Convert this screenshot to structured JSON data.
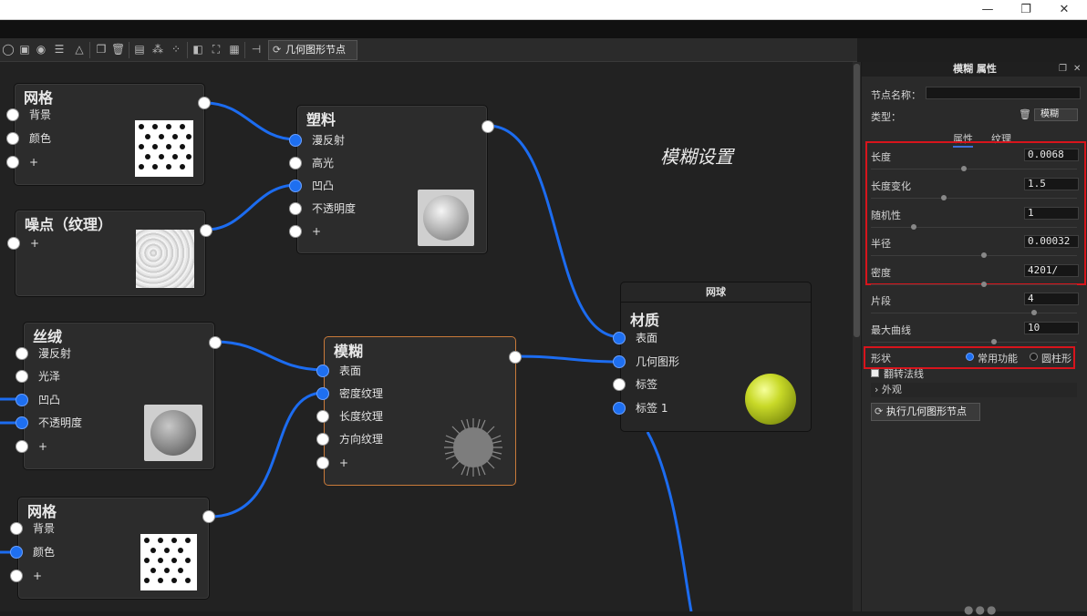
{
  "window": {
    "minimize": "—",
    "restore": "❐",
    "close": "✕"
  },
  "toolbar": {
    "icons": [
      "open-icon",
      "layout-icon",
      "render-icon",
      "sliders-icon",
      "measure-icon",
      "copy-icon",
      "delete-icon",
      "node-add-icon",
      "network-icon",
      "cluster-icon",
      "split-icon",
      "frame-icon",
      "grid-icon",
      "connect-icon"
    ],
    "tab_label": "几何图形节点"
  },
  "canvas": {
    "annotation": "模糊设置",
    "nodes": {
      "grid1": {
        "title": "网格",
        "inputs": [
          "背景",
          "颜色",
          "+"
        ]
      },
      "noise": {
        "title": "噪点（纹理）",
        "inputs": [
          "+"
        ]
      },
      "plastic": {
        "title": "塑料",
        "inputs": [
          "漫反射",
          "高光",
          "凹凸",
          "不透明度",
          "+"
        ]
      },
      "silk": {
        "title": "丝绒",
        "inputs": [
          "漫反射",
          "光泽",
          "凹凸",
          "不透明度",
          "+"
        ]
      },
      "blur": {
        "title": "模糊",
        "inputs": [
          "表面",
          "密度纹理",
          "长度纹理",
          "方向纹理",
          "+"
        ]
      },
      "grid2": {
        "title": "网格",
        "inputs": [
          "背景",
          "颜色",
          "+"
        ]
      },
      "ball": {
        "header": "网球",
        "title": "材质",
        "inputs": [
          "表面",
          "几何图形",
          "标签",
          "标签 1"
        ]
      }
    }
  },
  "panel": {
    "title": "模糊 属性",
    "node_name_label": "节点名称：",
    "node_name_value": "",
    "type_label": "类型：",
    "type_value": "模糊",
    "tabs": [
      "属性",
      "纹理"
    ],
    "properties": [
      {
        "label": "长度",
        "value": "0.0068",
        "level": 0.45
      },
      {
        "label": "长度变化",
        "value": "1.5",
        "level": 0.35
      },
      {
        "label": "随机性",
        "value": "1",
        "level": 0.2
      },
      {
        "label": "半径",
        "value": "0.00032",
        "level": 0.55
      },
      {
        "label": "密度",
        "value": "4201/",
        "level": 0.55
      },
      {
        "label": "片段",
        "value": "4",
        "level": 0.8
      },
      {
        "label": "最大曲线",
        "value": "10",
        "level": 0.6
      }
    ],
    "shape_label": "形状",
    "shape_options": [
      "常用功能",
      "圆柱形"
    ],
    "shape_selected": "常用功能",
    "flip_normals_label": "翻转法线",
    "appearance_section": "外观",
    "execute_button": "执行几何图形节点"
  }
}
